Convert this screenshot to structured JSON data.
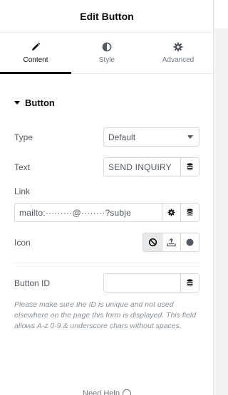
{
  "header": {
    "title": "Edit Button"
  },
  "tabs": [
    {
      "label": "Content",
      "icon": "pencil-icon",
      "active": true
    },
    {
      "label": "Style",
      "icon": "half-circle-icon",
      "active": false
    },
    {
      "label": "Advanced",
      "icon": "gear-icon",
      "active": false
    }
  ],
  "section": {
    "title": "Button"
  },
  "fields": {
    "type": {
      "label": "Type",
      "value": "Default"
    },
    "text": {
      "label": "Text",
      "value": "SEND INQUIRY"
    },
    "link": {
      "label": "Link",
      "value": "mailto:·········@········?subje"
    },
    "icon": {
      "label": "Icon"
    },
    "button_id": {
      "label": "Button ID",
      "value": ""
    }
  },
  "note": "Please make sure the ID is unique and not used elsewhere on the page this form is displayed. This field allows A-z 0-9 & underscore chars without spaces.",
  "footer": {
    "help_label": "Need Help"
  },
  "colors": {
    "accent": "#0c0d0e",
    "border": "#d5d8dc",
    "text": "#515962",
    "muted": "#8a939b"
  }
}
